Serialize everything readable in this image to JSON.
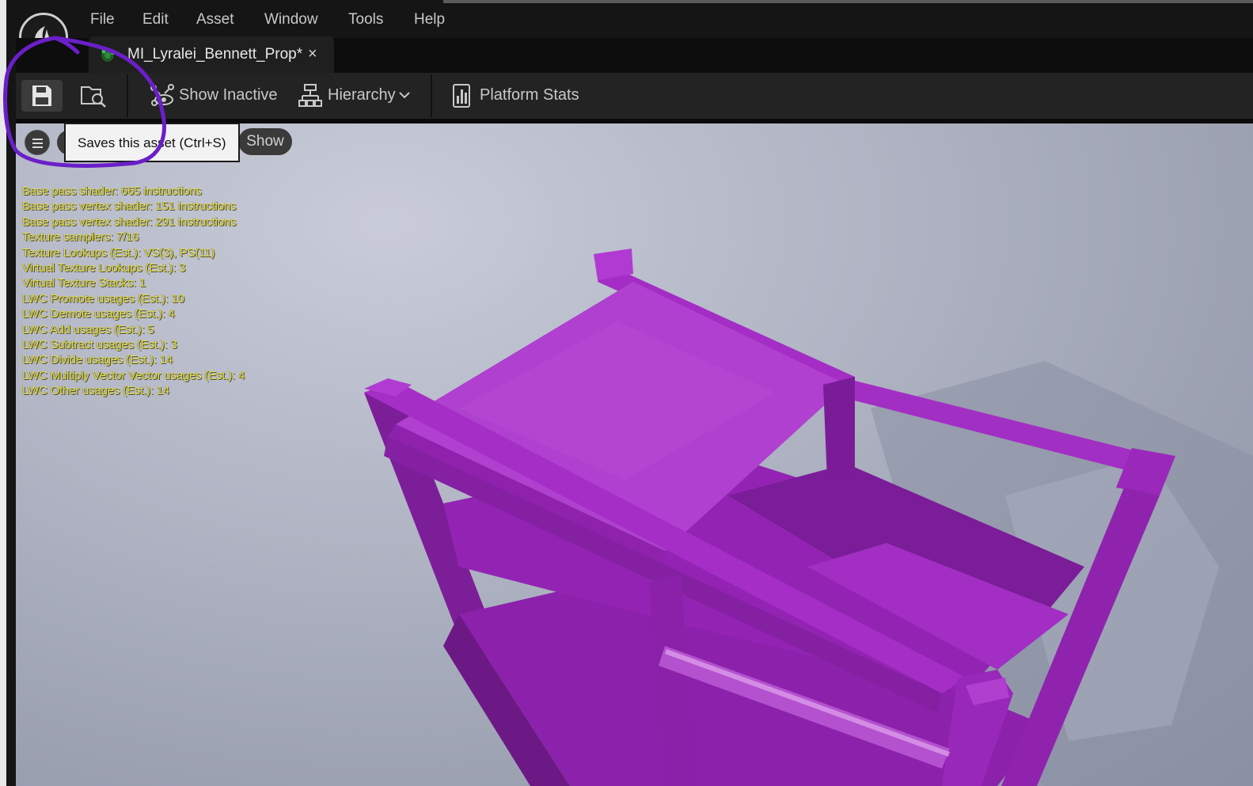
{
  "menubar": {
    "items": [
      {
        "label": "File"
      },
      {
        "label": "Edit"
      },
      {
        "label": "Asset"
      },
      {
        "label": "Window"
      },
      {
        "label": "Tools"
      },
      {
        "label": "Help"
      }
    ]
  },
  "tab": {
    "title": "MI_Lyralei_Bennett_Prop*",
    "close": "×"
  },
  "toolbar": {
    "show_inactive_label": "Show Inactive",
    "hierarchy_label": "Hierarchy",
    "platform_stats_label": "Platform Stats"
  },
  "tooltip": {
    "text": "Saves this asset (Ctrl+S)"
  },
  "viewport": {
    "show_label": "Show",
    "stats": [
      "Base pass shader: 665 instructions",
      "Base pass vertex shader: 151 instructions",
      "Base pass vertex shader: 291 instructions",
      "Texture samplers: 7/16",
      "Texture Lookups (Est.): VS(3), PS(11)",
      "Virtual Texture Lookups (Est.): 3",
      "Virtual Texture Stacks: 1",
      "LWC Promote usages (Est.): 10",
      "LWC Demote usages (Est.): 4",
      "LWC Add usages (Est.): 5",
      "LWC Subtract usages (Est.): 3",
      "LWC Divide usages (Est.): 14",
      "LWC Multiply Vector Vector usages (Est.): 4",
      "LWC Other usages (Est.): 14"
    ]
  },
  "colors": {
    "preview_mesh": "#a429c4",
    "annotation_ring": "#6a1fc8",
    "stats_text": "#e6e04a"
  }
}
